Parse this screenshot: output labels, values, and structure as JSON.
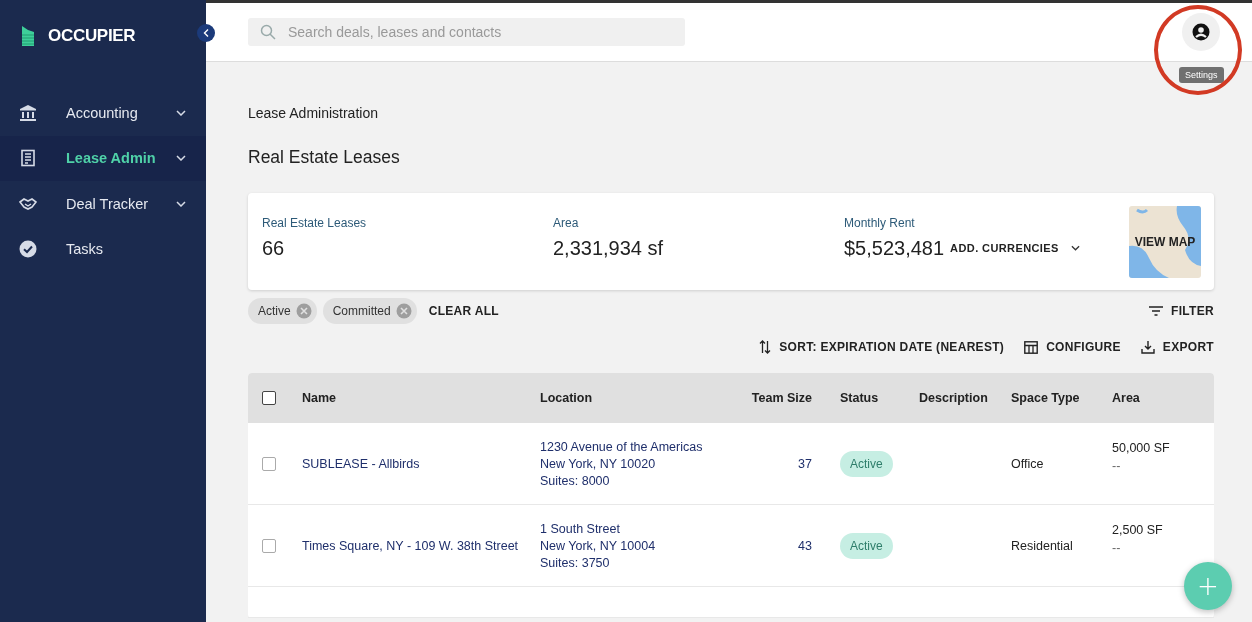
{
  "sidebar": {
    "logo": "OCCUPIER",
    "items": [
      {
        "label": "Accounting",
        "selected": false,
        "expandable": true
      },
      {
        "label": "Lease Admin",
        "selected": true,
        "expandable": true
      },
      {
        "label": "Deal Tracker",
        "selected": false,
        "expandable": true
      },
      {
        "label": "Tasks",
        "selected": false,
        "expandable": false
      }
    ]
  },
  "search": {
    "placeholder": "Search deals, leases and contacts"
  },
  "tooltip": "Settings",
  "breadcrumb": "Lease Administration",
  "page_title": "Real Estate Leases",
  "stats": [
    {
      "label": "Real Estate Leases",
      "value": "66"
    },
    {
      "label": "Area",
      "value": "2,331,934 sf"
    },
    {
      "label": "Monthly Rent",
      "value": "$5,523,481",
      "action": "ADD. CURRENCIES"
    }
  ],
  "map_button": "VIEW MAP",
  "filters": [
    {
      "label": "Active"
    },
    {
      "label": "Committed"
    }
  ],
  "clear_all": "CLEAR ALL",
  "filter_button": "FILTER",
  "toolbar": [
    {
      "kind": "sort",
      "label": "SORT: EXPIRATION DATE (NEAREST)"
    },
    {
      "kind": "configure",
      "label": "CONFIGURE"
    },
    {
      "kind": "export",
      "label": "EXPORT"
    }
  ],
  "table": {
    "all_checked": false,
    "columns": [
      "Name",
      "Location",
      "Team Size",
      "Status",
      "Description",
      "Space Type",
      "Area"
    ],
    "rows": [
      {
        "checked": false,
        "name": "SUBLEASE - Allbirds",
        "location": [
          "1230 Avenue of the Americas",
          "New York, NY 10020",
          "Suites: 8000"
        ],
        "team_size": "37",
        "status": "Active",
        "space_type": "Office",
        "area": "50,000 SF",
        "area_note": "--"
      },
      {
        "checked": false,
        "name": "Times Square, NY - 109 W. 38th Street",
        "location": [
          "1 South Street",
          "New York, NY 10004",
          "Suites: 3750"
        ],
        "team_size": "43",
        "status": "Active",
        "space_type": "Residential",
        "area": "2,500 SF",
        "area_note": "--"
      }
    ]
  },
  "fab": "+"
}
